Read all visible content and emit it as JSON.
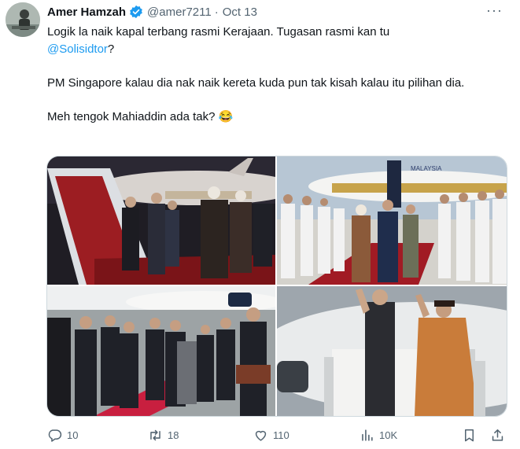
{
  "tweet": {
    "author_name": "Amer Hamzah",
    "handle": "@amer7211",
    "separator": "·",
    "date": "Oct 13",
    "more": "···",
    "line1_before": "Logik la naik kapal terbang rasmi Kerajaan. Tugasan rasmi kan tu",
    "mention": "@Solisidtor",
    "line1_after": "?",
    "paragraph2": "PM Singapore kalau dia nak naik kereta kuda pun tak kisah kalau itu pilihan dia.",
    "paragraph3": "Meh tengok Mahiaddin ada tak? 😂",
    "photo3_caption_visible": "MALAYSIA"
  },
  "actions": {
    "replies": "10",
    "retweets": "18",
    "likes": "110",
    "views": "10K"
  },
  "icons": {
    "verified": "verified-badge-icon",
    "reply": "reply-icon",
    "retweet": "retweet-icon",
    "like": "heart-icon",
    "views": "views-chart-icon",
    "bookmark": "bookmark-icon",
    "share": "share-icon"
  },
  "colors": {
    "text": "#0f1419",
    "secondary": "#536471",
    "accent": "#1d9bf0"
  }
}
